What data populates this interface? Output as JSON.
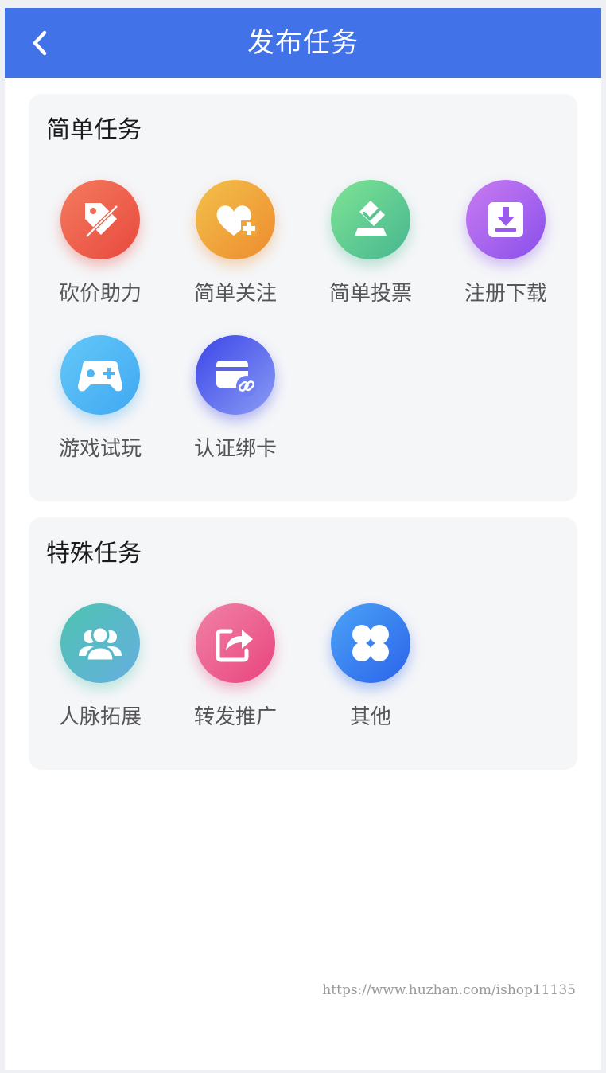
{
  "header": {
    "title": "发布任务",
    "background": "#4272e8"
  },
  "simple": {
    "title": "简单任务",
    "items": [
      {
        "label": "砍价助力",
        "icon": "price-tag-icon",
        "colors": [
          "#f47b5f",
          "#e8493d"
        ]
      },
      {
        "label": "简单关注",
        "icon": "heart-plus-icon",
        "colors": [
          "#f2c14a",
          "#ee8b2f"
        ]
      },
      {
        "label": "简单投票",
        "icon": "ballot-box-icon",
        "colors": [
          "#7ee494",
          "#46b690"
        ]
      },
      {
        "label": "注册下载",
        "icon": "download-icon",
        "colors": [
          "#c97bf2",
          "#8950ea"
        ]
      },
      {
        "label": "游戏试玩",
        "icon": "gamepad-icon",
        "colors": [
          "#63c8f8",
          "#41a8f2"
        ]
      },
      {
        "label": "认证绑卡",
        "icon": "card-link-icon",
        "colors": [
          "#3b45e8",
          "#8a9cf4"
        ]
      }
    ]
  },
  "special": {
    "title": "特殊任务",
    "items": [
      {
        "label": "人脉拓展",
        "icon": "contacts-icon",
        "colors": [
          "#4dc3b0",
          "#66aee0"
        ]
      },
      {
        "label": "转发推广",
        "icon": "share-icon",
        "colors": [
          "#f082a6",
          "#e9457e"
        ]
      },
      {
        "label": "其他",
        "icon": "more-icon",
        "colors": [
          "#4aa3f6",
          "#2c63ea"
        ]
      }
    ]
  },
  "watermark": "https://www.huzhan.com/ishop11135"
}
